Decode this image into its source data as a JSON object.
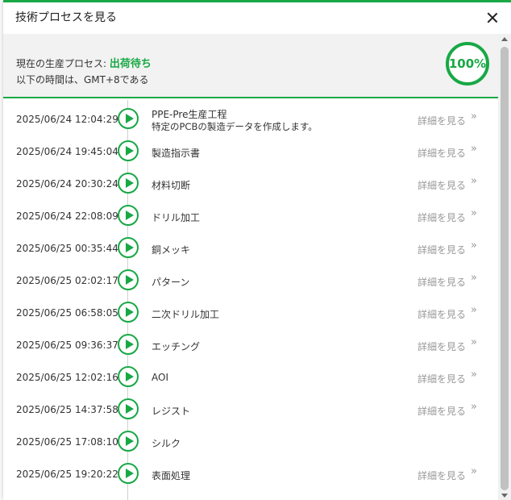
{
  "modal": {
    "title": "技術プロセスを見る"
  },
  "status": {
    "label": "現在の生産プロセス: ",
    "value": "出荷待ち",
    "timezone_note": "以下の時間は、GMT+8である",
    "progress": "100%",
    "accent_color": "#18a845"
  },
  "detail_label": "詳細を見る",
  "chevron": "»",
  "rows": [
    {
      "time": "2025/06/24 12:04:29",
      "name": "PPE-Pre生産工程",
      "sub": "特定のPCBの製造データを作成します。",
      "detail": "詳細を見る"
    },
    {
      "time": "2025/06/24 19:45:04",
      "name": "製造指示書",
      "sub": "",
      "detail": "詳細を見る"
    },
    {
      "time": "2025/06/24 20:30:24",
      "name": "材料切断",
      "sub": "",
      "detail": "詳細を見る"
    },
    {
      "time": "2025/06/24 22:08:09",
      "name": "ドリル加工",
      "sub": "",
      "detail": "詳細を見る"
    },
    {
      "time": "2025/06/25 00:35:44",
      "name": "銅メッキ",
      "sub": "",
      "detail": "詳細を見る"
    },
    {
      "time": "2025/06/25 02:02:17",
      "name": "パターン",
      "sub": "",
      "detail": "詳細を見る"
    },
    {
      "time": "2025/06/25 06:58:05",
      "name": "二次ドリル加工",
      "sub": "",
      "detail": "詳細を見る"
    },
    {
      "time": "2025/06/25 09:36:37",
      "name": "エッチング",
      "sub": "",
      "detail": "詳細を見る"
    },
    {
      "time": "2025/06/25 12:02:16",
      "name": "AOI",
      "sub": "",
      "detail": "詳細を見る"
    },
    {
      "time": "2025/06/25 14:37:58",
      "name": "レジスト",
      "sub": "",
      "detail": "詳細を見る"
    },
    {
      "time": "2025/06/25 17:08:10",
      "name": "シルク",
      "sub": "",
      "detail": ""
    },
    {
      "time": "2025/06/25 19:20:22",
      "name": "表面処理",
      "sub": "",
      "detail": "詳細を見る"
    }
  ]
}
